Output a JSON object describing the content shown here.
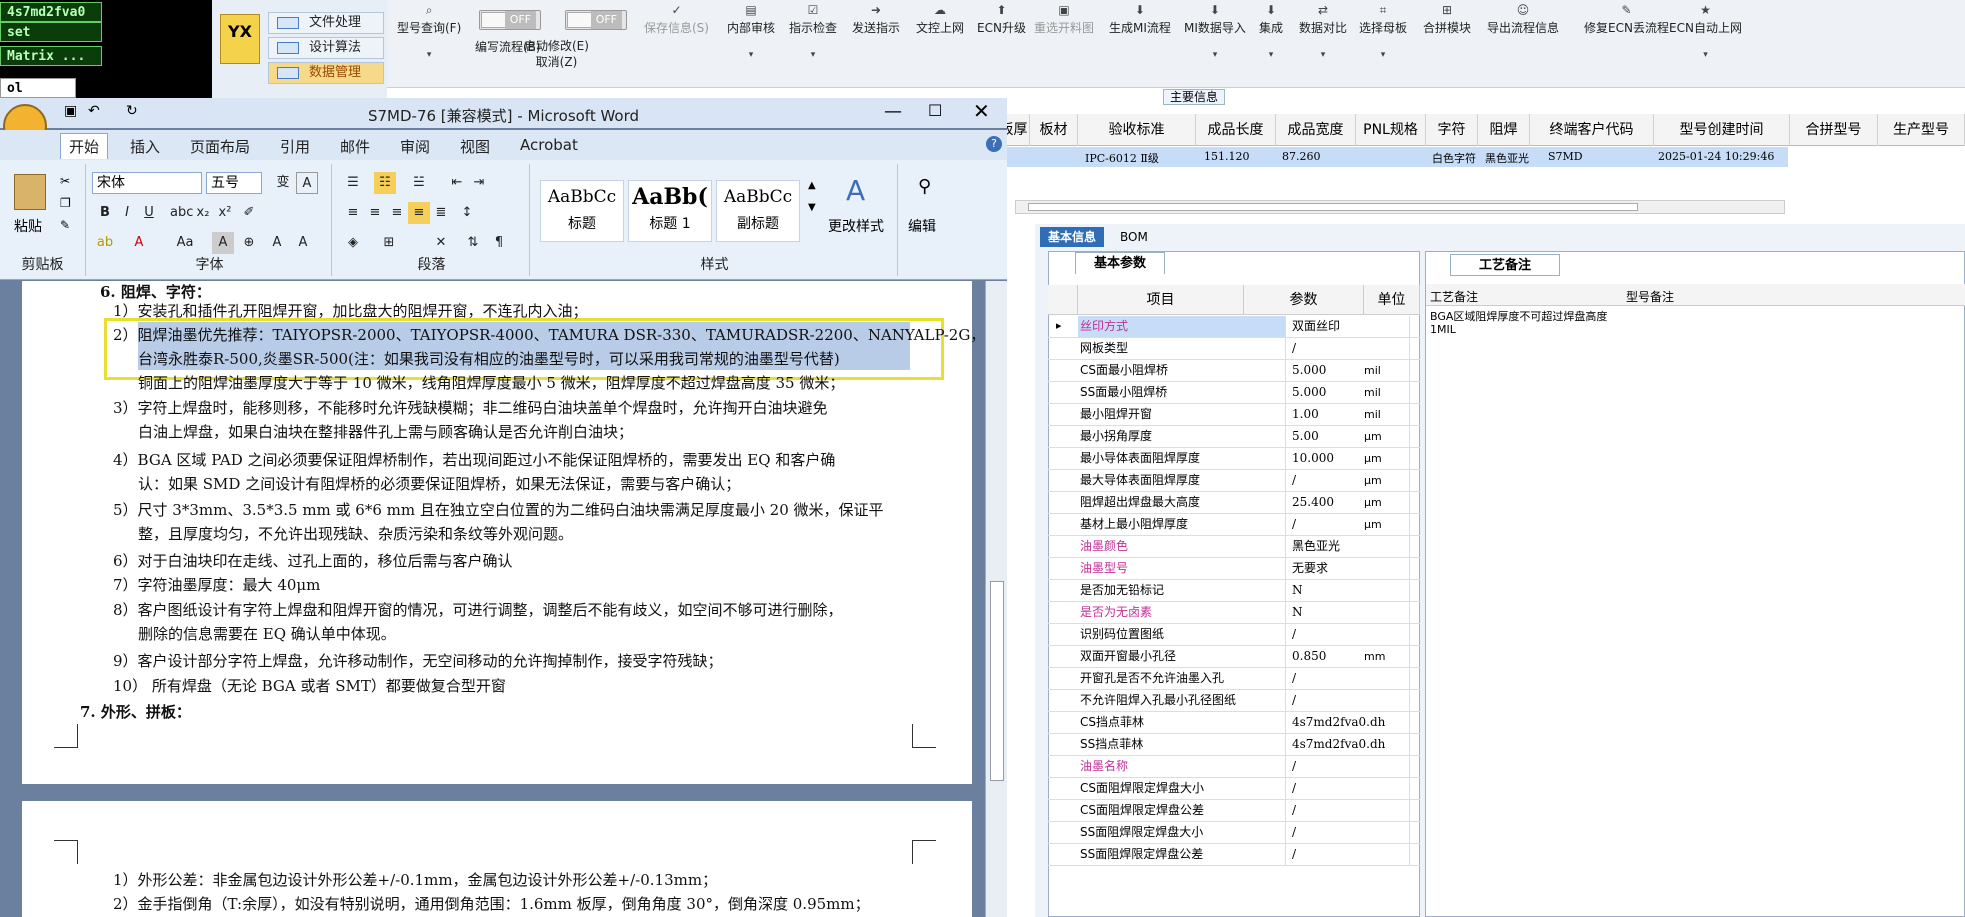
{
  "left_panel": {
    "fields": [
      "4s7md2fva0",
      "set",
      "Matrix ...",
      "ol"
    ]
  },
  "nav": {
    "logo_text": "YX",
    "items": [
      "文件处理",
      "设计算法",
      "数据管理"
    ]
  },
  "toolbar": {
    "items": [
      {
        "label": "型号查询(F)",
        "icon": "search-icon",
        "dropdown": true
      },
      {
        "label": "编写流程(B)",
        "toggle": "OFF"
      },
      {
        "label": "启动修改(E)\n取消(Z)",
        "toggle": "OFF"
      },
      {
        "label": "保存信息(S)",
        "icon": "check-icon",
        "disabled": true
      },
      {
        "label": "内部审核",
        "icon": "print-icon",
        "dropdown": true
      },
      {
        "label": "指示检查",
        "icon": "check-icon",
        "dropdown": true
      },
      {
        "label": "发送指示",
        "icon": "arrow-icon"
      },
      {
        "label": "文控上网",
        "icon": "upload-icon"
      },
      {
        "label": "ECN升级",
        "icon": "upgrade-icon"
      },
      {
        "label": "重选开料图",
        "icon": "image-icon",
        "disabled": true
      },
      {
        "label": "生成MI流程",
        "icon": "download-icon"
      },
      {
        "label": "MI数据导入",
        "icon": "download-icon",
        "dropdown": true
      },
      {
        "label": "集成",
        "icon": "download-icon",
        "dropdown": true
      },
      {
        "label": "数据对比",
        "icon": "compare-icon",
        "dropdown": true
      },
      {
        "label": "选择母板",
        "icon": "board-icon",
        "dropdown": true
      },
      {
        "label": "合拼模块",
        "icon": "merge-icon"
      },
      {
        "label": "导出流程信息",
        "icon": "smile-icon"
      },
      {
        "label": "修复ECN丢流程",
        "icon": "edit-icon"
      },
      {
        "label": "ECN自动上网",
        "icon": "star-icon",
        "dropdown": true
      }
    ]
  },
  "main_info_label": "主要信息",
  "grid": {
    "headers": [
      "板厚",
      "板材",
      "验收标准",
      "成品长度",
      "成品宽度",
      "PNL规格",
      "字符",
      "阻焊",
      "终端客户代码",
      "型号创建时间",
      "合拼型号",
      "生产型号"
    ],
    "row": [
      "",
      "",
      "IPC-6012 Ⅱ级",
      "151.120",
      "87.260",
      "",
      "白色字符",
      "黑色亚光",
      "S7MD",
      "2025-01-24 10:29:46"
    ]
  },
  "bottom_tabs": [
    "基本信息",
    "BOM"
  ],
  "basic_params": {
    "tab_label": "基本参数",
    "headers": [
      "项目",
      "参数",
      "单位"
    ],
    "rows": [
      {
        "item": "丝印方式",
        "value": "双面丝印",
        "unit": "",
        "pink": true
      },
      {
        "item": "网板类型",
        "value": "/",
        "unit": ""
      },
      {
        "item": "CS面最小阻焊桥",
        "value": "5.000",
        "unit": "mil"
      },
      {
        "item": "SS面最小阻焊桥",
        "value": "5.000",
        "unit": "mil"
      },
      {
        "item": "最小阻焊开窗",
        "value": "1.00",
        "unit": "mil"
      },
      {
        "item": "最小拐角厚度",
        "value": "5.00",
        "unit": "μm"
      },
      {
        "item": "最小导体表面阻焊厚度",
        "value": "10.000",
        "unit": "μm"
      },
      {
        "item": "最大导体表面阻焊厚度",
        "value": "/",
        "unit": "μm"
      },
      {
        "item": "阻焊超出焊盘最大高度",
        "value": "25.400",
        "unit": "μm"
      },
      {
        "item": "基材上最小阻焊厚度",
        "value": "/",
        "unit": "μm"
      },
      {
        "item": "油墨颜色",
        "value": "黑色亚光",
        "unit": "",
        "pink": true
      },
      {
        "item": "油墨型号",
        "value": "无要求",
        "unit": "",
        "pink": true
      },
      {
        "item": "是否加无铅标记",
        "value": "N",
        "unit": ""
      },
      {
        "item": "是否为无卤素",
        "value": "N",
        "unit": "",
        "pink": true
      },
      {
        "item": "识别码位置图纸",
        "value": "/",
        "unit": ""
      },
      {
        "item": "双面开窗最小孔径",
        "value": "0.850",
        "unit": "mm"
      },
      {
        "item": "开窗孔是否不允许油墨入孔",
        "value": "/",
        "unit": ""
      },
      {
        "item": "不允许阻焊入孔最小孔径图纸",
        "value": "/",
        "unit": ""
      },
      {
        "item": "CS挡点菲林",
        "value": "4s7md2fva0.dh",
        "unit": ""
      },
      {
        "item": "SS挡点菲林",
        "value": "4s7md2fva0.dh",
        "unit": ""
      },
      {
        "item": "油墨名称",
        "value": "/",
        "unit": "",
        "pink": true
      },
      {
        "item": "CS面阻焊限定焊盘大小",
        "value": "/",
        "unit": ""
      },
      {
        "item": "CS面阻焊限定焊盘公差",
        "value": "/",
        "unit": ""
      },
      {
        "item": "SS面阻焊限定焊盘大小",
        "value": "/",
        "unit": ""
      },
      {
        "item": "SS面阻焊限定焊盘公差",
        "value": "/",
        "unit": ""
      }
    ]
  },
  "process_notes": {
    "tab_label": "工艺备注",
    "col1": "工艺备注",
    "col2": "型号备注",
    "note": "BGA区域阻焊厚度不可超过焊盘高度1MIL"
  },
  "word": {
    "title": "S7MD-76 [兼容模式] - Microsoft Word",
    "tabs": [
      "开始",
      "插入",
      "页面布局",
      "引用",
      "邮件",
      "审阅",
      "视图",
      "Acrobat"
    ],
    "font_name": "宋体",
    "font_size": "五号",
    "groups": {
      "clipboard": "剪贴板",
      "paste": "粘贴",
      "font": "字体",
      "paragraph": "段落",
      "styles": "样式",
      "edit": "编辑"
    },
    "styles": [
      {
        "sample": "AaBbCc",
        "name": "标题"
      },
      {
        "sample": "AaBb(",
        "name": "标题 1"
      },
      {
        "sample": "AaBbCc",
        "name": "副标题"
      }
    ],
    "more_styles": "更改样式",
    "doc_lines": [
      "6.  阻焊、字符：",
      "1）安装孔和插件孔开阻焊开窗，加比盘大的阻焊开窗，不连孔内入油；",
      "2）阻焊油墨优先推荐：TAIYOPSR-2000、TAIYOPSR-4000、TAMURA  DSR-330、TAMURADSR-2200、NANYALP-2G，",
      "台湾永胜泰R-500,炎墨SR-500(注：如果我司没有相应的油墨型号时，可以采用我司常规的油墨型号代替)",
      "铜面上的阻焊油墨厚度大于等于 10 微米，线角阻焊厚度最小 5 微米，阻焊厚度不超过焊盘高度 35 微米；",
      "3）字符上焊盘时，能移则移，不能移时允许残缺模糊；非二维码白油块盖单个焊盘时，允许掏开白油块避免",
      "白油上焊盘，如果白油块在整排器件孔上需与顾客确认是否允许削白油块；",
      "4）BGA 区域 PAD 之间必须要保证阻焊桥制作，若出现间距过小不能保证阻焊桥的，需要发出 EQ 和客户确",
      "认：如果 SMD 之间设计有阻焊桥的必须要保证阻焊桥，如果无法保证，需要与客户确认；",
      "5）尺寸 3*3mm、3.5*3.5 mm 或 6*6 mm 且在独立空白位置的为二维码白油块需满足厚度最小 20 微米，保证平",
      "整，且厚度均匀，不允许出现残缺、杂质污染和条纹等外观问题。",
      "6）对于白油块印在走线、过孔上面的，移位后需与客户确认",
      "7）字符油墨厚度：最大 40μm",
      "8）客户图纸设计有字符上焊盘和阻焊开窗的情况，可进行调整，调整后不能有歧义，如空间不够可进行删除，",
      "删除的信息需要在 EQ 确认单中体现。",
      "9）客户设计部分字符上焊盘，允许移动制作，无空间移动的允许掏掉制作，接受字符残缺；",
      "10）    所有焊盘（无论 BGA 或者 SMT）都要做复合型开窗",
      "7.   外形、拼板：",
      "1）外形公差：非金属包边设计外形公差+/-0.1mm，金属包边设计外形公差+/-0.13mm；",
      "2）金手指倒角（T:余厚），如没有特别说明，通用倒角范围：1.6mm 板厚，倒角角度 30°，倒角深度 0.95mm；"
    ]
  }
}
